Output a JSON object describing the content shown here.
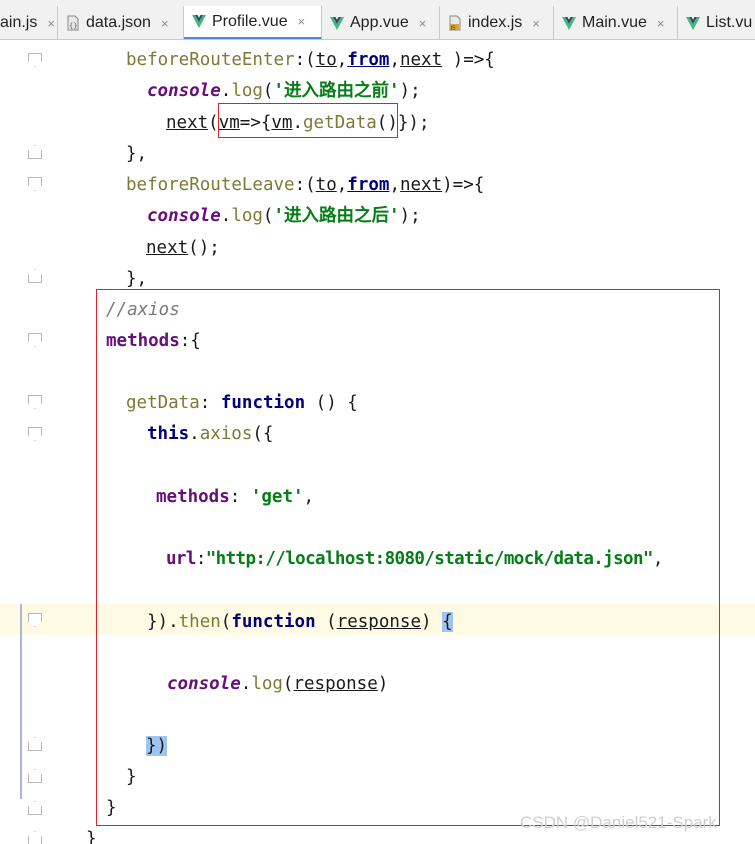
{
  "tabs": [
    {
      "label": "ain.js",
      "icon": "js-file-icon",
      "active": false
    },
    {
      "label": "data.json",
      "icon": "json-file-icon",
      "active": false
    },
    {
      "label": "Profile.vue",
      "icon": "vue-file-icon",
      "active": true
    },
    {
      "label": "App.vue",
      "icon": "vue-file-icon",
      "active": false
    },
    {
      "label": "index.js",
      "icon": "js-file-icon",
      "active": false
    },
    {
      "label": "Main.vue",
      "icon": "vue-file-icon",
      "active": false
    },
    {
      "label": "List.vu",
      "icon": "vue-file-icon",
      "active": false
    }
  ],
  "close_glyph": "×",
  "colors": {
    "vue_green": "#41b883",
    "highlight_box": "#d9242b",
    "current_line": "#fffae3"
  },
  "code": {
    "l1": {
      "a": "beforeRouteEnter",
      "b": ":(",
      "c": "to",
      "d": ",",
      "e": "from",
      "f": ",",
      "g": "next",
      "h": " )=>{"
    },
    "l2": {
      "a": "console",
      "b": ".",
      "c": "log",
      "d": "(",
      "e": "'进入路由之前'",
      "f": ");"
    },
    "l3": {
      "a": "next",
      "b": "(",
      "c": "vm",
      "d": "=>{",
      "e": "vm",
      "f": ".",
      "g": "getData",
      "h": "()})",
      "i": ";"
    },
    "l4": "},",
    "l5": {
      "a": "beforeRouteLeave",
      "b": ":(",
      "c": "to",
      "d": ",",
      "e": "from",
      "f": ",",
      "g": "next",
      "h": ")=>{"
    },
    "l6": {
      "a": "console",
      "b": ".",
      "c": "log",
      "d": "(",
      "e": "'进入路由之后'",
      "f": ");"
    },
    "l7": {
      "a": "next",
      "b": "();"
    },
    "l8": "},",
    "l9": "//axios",
    "l10": {
      "a": "methods",
      "b": ":{"
    },
    "l11": {
      "a": "getData",
      "b": ": ",
      "c": "function",
      "d": " () {"
    },
    "l12": {
      "a": "this",
      "b": ".",
      "c": "axios",
      "d": "({"
    },
    "l13": {
      "a": "methods",
      "b": ": ",
      "c": "'get'",
      "d": ","
    },
    "l14": {
      "a": "url",
      "b": ":",
      "c": "\"http://localhost:8080/static/mock/data.json\"",
      "d": ","
    },
    "l15": {
      "a": "})",
      "b": ".",
      "c": "then",
      "d": "(",
      "e": "function",
      "f": " (",
      "g": "response",
      "h": ") ",
      "i": "{"
    },
    "l16": {
      "a": "console",
      "b": ".",
      "c": "log",
      "d": "(",
      "e": "response",
      "f": ")"
    },
    "l17": "})",
    "l18": "}",
    "l19": "}",
    "l20": "}"
  },
  "watermark": "CSDN @Daniel521-Spark"
}
